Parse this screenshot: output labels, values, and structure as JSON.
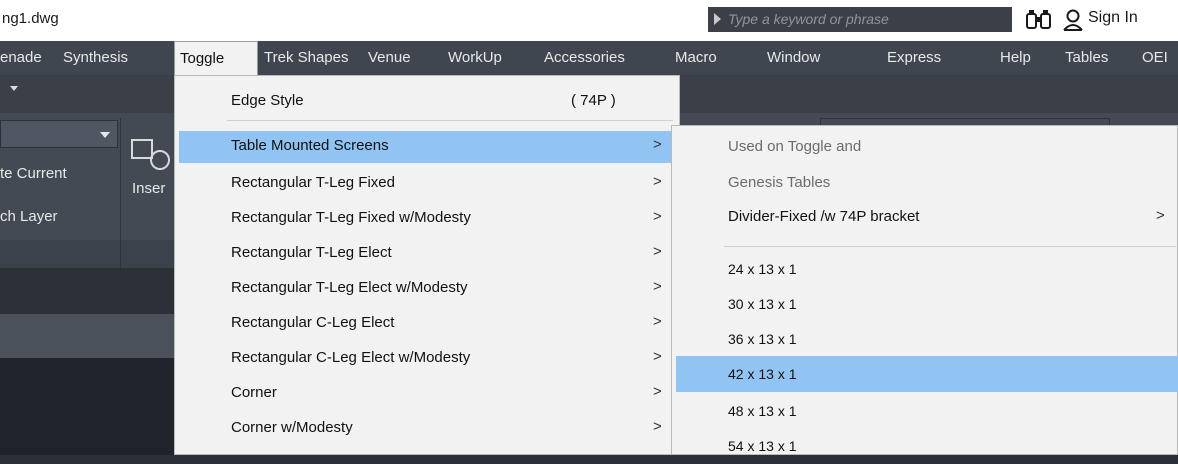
{
  "titlebar": {
    "doc_title": "ng1.dwg",
    "search_placeholder": "Type a keyword or phrase",
    "sign_in": "Sign In"
  },
  "menubar": {
    "items": [
      "enade",
      "Synthesis",
      "Toggle",
      "Trek Shapes",
      "Venue",
      "WorkUp",
      "Accessories",
      "Macro",
      "Window",
      "Express",
      "Help",
      "Tables",
      "OEI"
    ]
  },
  "ribbon": {
    "current_label": "te Current",
    "layer_label": "ch Layer",
    "insert_label": "Inser"
  },
  "toggle_menu": {
    "items": [
      {
        "label": "Edge Style",
        "shortcut": "( 74P )",
        "arrow": ""
      },
      {
        "label": "Table Mounted Screens",
        "arrow": ">"
      },
      {
        "label": "Rectangular T-Leg Fixed",
        "arrow": ">"
      },
      {
        "label": "Rectangular T-Leg Fixed w/Modesty",
        "arrow": ">"
      },
      {
        "label": "Rectangular T-Leg Elect",
        "arrow": ">"
      },
      {
        "label": "Rectangular T-Leg Elect w/Modesty",
        "arrow": ">"
      },
      {
        "label": "Rectangular C-Leg Elect",
        "arrow": ">"
      },
      {
        "label": "Rectangular C-Leg Elect w/Modesty",
        "arrow": ">"
      },
      {
        "label": "Corner",
        "arrow": ">"
      },
      {
        "label": "Corner w/Modesty",
        "arrow": ">"
      }
    ]
  },
  "submenu": {
    "items": [
      {
        "label": "Used on Toggle and",
        "arrow": ""
      },
      {
        "label": "Genesis Tables",
        "arrow": ""
      },
      {
        "label": "Divider-Fixed /w 74P bracket",
        "arrow": ">"
      },
      {
        "label": "24 x 13 x 1",
        "arrow": ""
      },
      {
        "label": "30 x 13 x 1",
        "arrow": ""
      },
      {
        "label": "36 x 13 x 1",
        "arrow": ""
      },
      {
        "label": "42 x 13 x 1",
        "arrow": ""
      },
      {
        "label": "48 x 13 x 1",
        "arrow": ""
      },
      {
        "label": "54 x 13 x 1",
        "arrow": ""
      }
    ]
  },
  "colors": {
    "highlight": "#91c4f2",
    "menu_bg": "#f2f2f2",
    "menubar_bg": "#3f4650"
  },
  "icons": [
    "search-arrow-icon",
    "binoculars-icon",
    "user-icon",
    "insert-block-icon",
    "chevron-right-icon",
    "dropdown-caret-icon"
  ]
}
